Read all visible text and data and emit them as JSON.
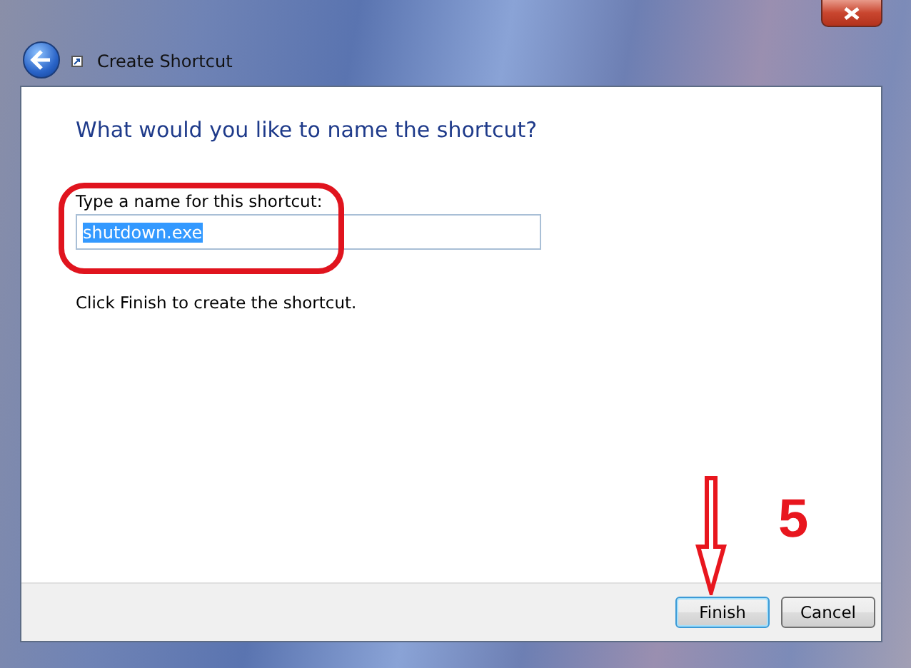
{
  "window": {
    "title": "Create Shortcut"
  },
  "heading": "What would you like to name the shortcut?",
  "name_field": {
    "label": "Type a name for this shortcut:",
    "value": "shutdown.exe",
    "text_selected": true
  },
  "hint": "Click Finish to create the shortcut.",
  "buttons": [
    {
      "label": "Finish",
      "default": true
    },
    {
      "label": "Cancel",
      "default": false
    }
  ],
  "annotation": {
    "step": "5"
  }
}
